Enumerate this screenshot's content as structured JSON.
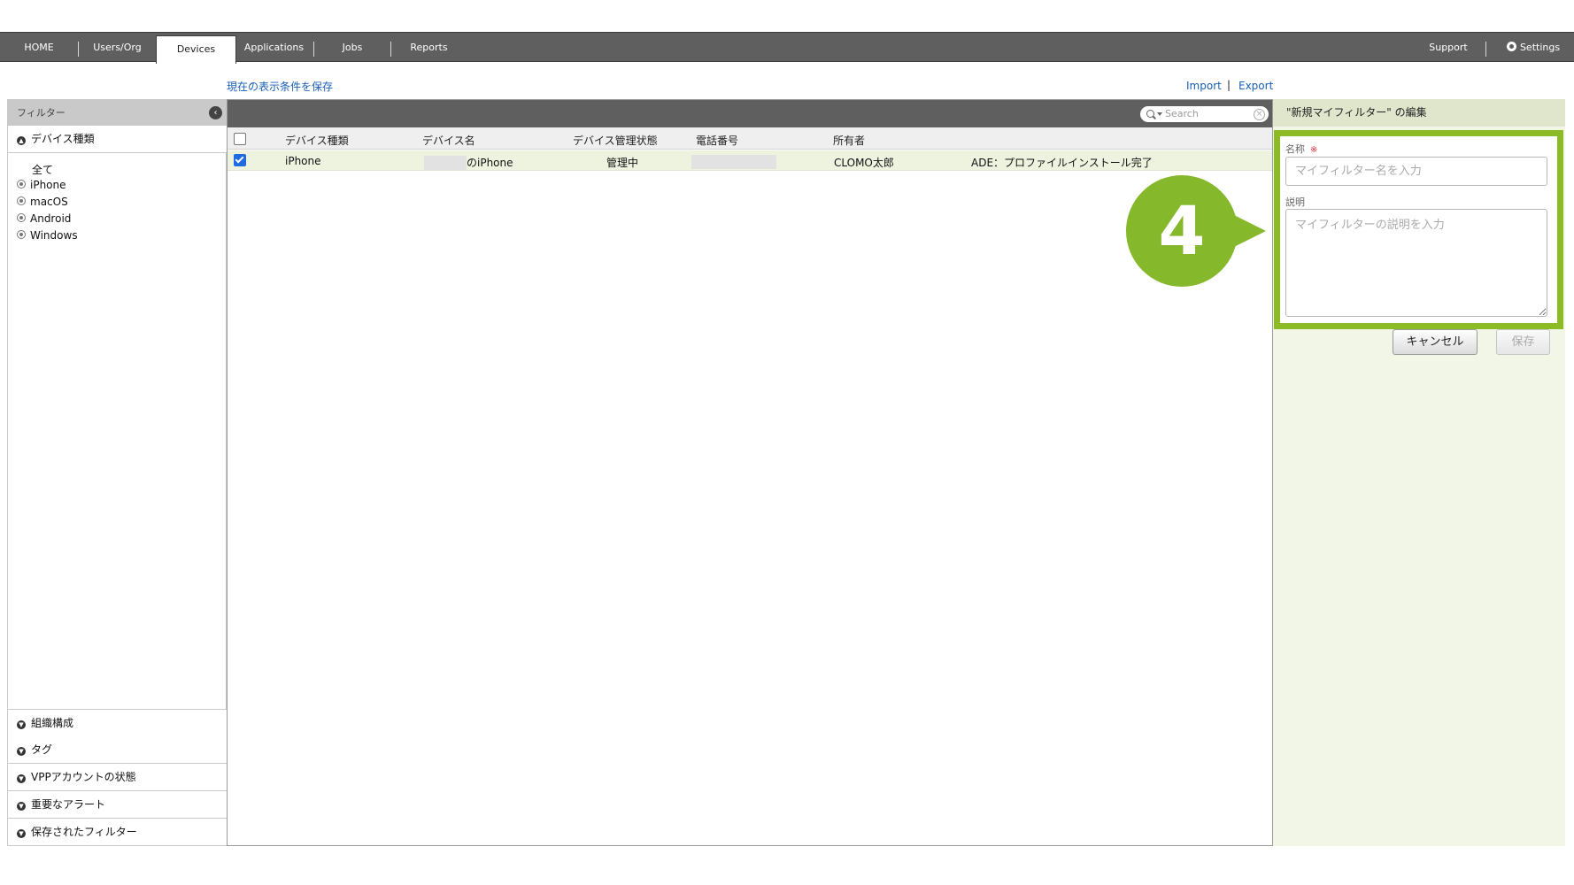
{
  "nav": {
    "items": [
      {
        "label": "HOME"
      },
      {
        "label": "Users/Org"
      },
      {
        "label": "Devices"
      },
      {
        "label": "Applications"
      },
      {
        "label": "Jobs"
      },
      {
        "label": "Reports"
      }
    ],
    "active": "Devices",
    "support": "Support",
    "settings": "Settings"
  },
  "links": {
    "save_view": "現在の表示条件を保存",
    "import": "Import",
    "separator": "|",
    "export": "Export"
  },
  "filter": {
    "title": "フィルター",
    "device_type_section": "デバイス種類",
    "device_types": [
      "全て",
      "iPhone",
      "macOS",
      "Android",
      "Windows"
    ],
    "bottom_sections": [
      "組織構成",
      "タグ",
      "VPPアカウントの状態",
      "重要なアラート",
      "保存されたフィルター"
    ]
  },
  "grid": {
    "search_placeholder": "Search",
    "columns": [
      "デバイス種類",
      "デバイス名",
      "デバイス管理状態",
      "電話番号",
      "所有者"
    ],
    "rows": [
      {
        "checked": true,
        "device_type": "iPhone",
        "device_name": "のiPhone",
        "status": "管理中",
        "phone": "",
        "owner": "CLOMO太郎",
        "note": "ADE：プロファイルインストール完了"
      }
    ]
  },
  "edit": {
    "header": "\"新規マイフィルター\" の編集",
    "name_label": "名称",
    "required_mark": "※",
    "name_placeholder": "マイフィルター名を入力",
    "name_value": "",
    "desc_label": "説明",
    "desc_placeholder": "マイフィルターの説明を入力",
    "desc_value": "",
    "cancel": "キャンセル",
    "save": "保存"
  },
  "callout": {
    "step": "4"
  },
  "colors": {
    "nav_bg": "#5f5f5f",
    "highlight": "#8cbb26",
    "link": "#1a5fb4",
    "selected_row": "#eef3e0",
    "edit_panel_bg": "#f1f6e6"
  },
  "icons": {
    "collapse": "chevron-left-circle-icon",
    "expanded": "chevron-up-circle-icon",
    "collapsed": "chevron-down-circle-icon",
    "search": "search-icon",
    "clear": "clear-icon",
    "settings": "gear-icon"
  }
}
